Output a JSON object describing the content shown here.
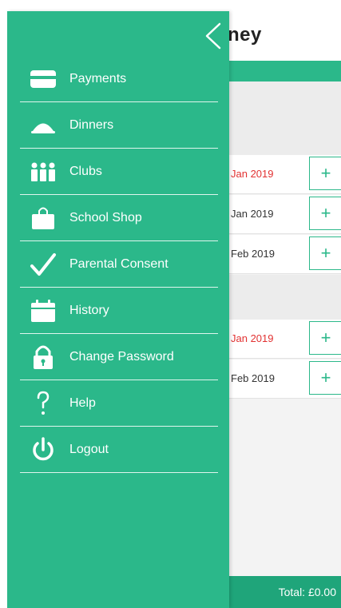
{
  "header": {
    "title": "ney"
  },
  "drawer": {
    "items": [
      {
        "label": "Payments",
        "icon": "card-icon"
      },
      {
        "label": "Dinners",
        "icon": "dish-icon"
      },
      {
        "label": "Clubs",
        "icon": "people-icon"
      },
      {
        "label": "School Shop",
        "icon": "bag-icon"
      },
      {
        "label": "Parental Consent",
        "icon": "check-icon"
      },
      {
        "label": "History",
        "icon": "calendar-icon"
      },
      {
        "label": "Change Password",
        "icon": "lock-icon"
      },
      {
        "label": "Help",
        "icon": "question-icon"
      },
      {
        "label": "Logout",
        "icon": "power-icon"
      }
    ]
  },
  "list": {
    "rows": [
      {
        "date": "Jan 2019",
        "highlight": true
      },
      {
        "date": "Jan 2019",
        "highlight": false
      },
      {
        "date": "Feb 2019",
        "highlight": false
      },
      {
        "date": "Jan 2019",
        "highlight": true
      },
      {
        "date": "Feb 2019",
        "highlight": false
      }
    ],
    "add_symbol": "+"
  },
  "footer": {
    "total": "Total: £0.00"
  },
  "colors": {
    "teal": "#2bb88a",
    "dark_teal": "#1fa57a",
    "red": "#e23232"
  }
}
